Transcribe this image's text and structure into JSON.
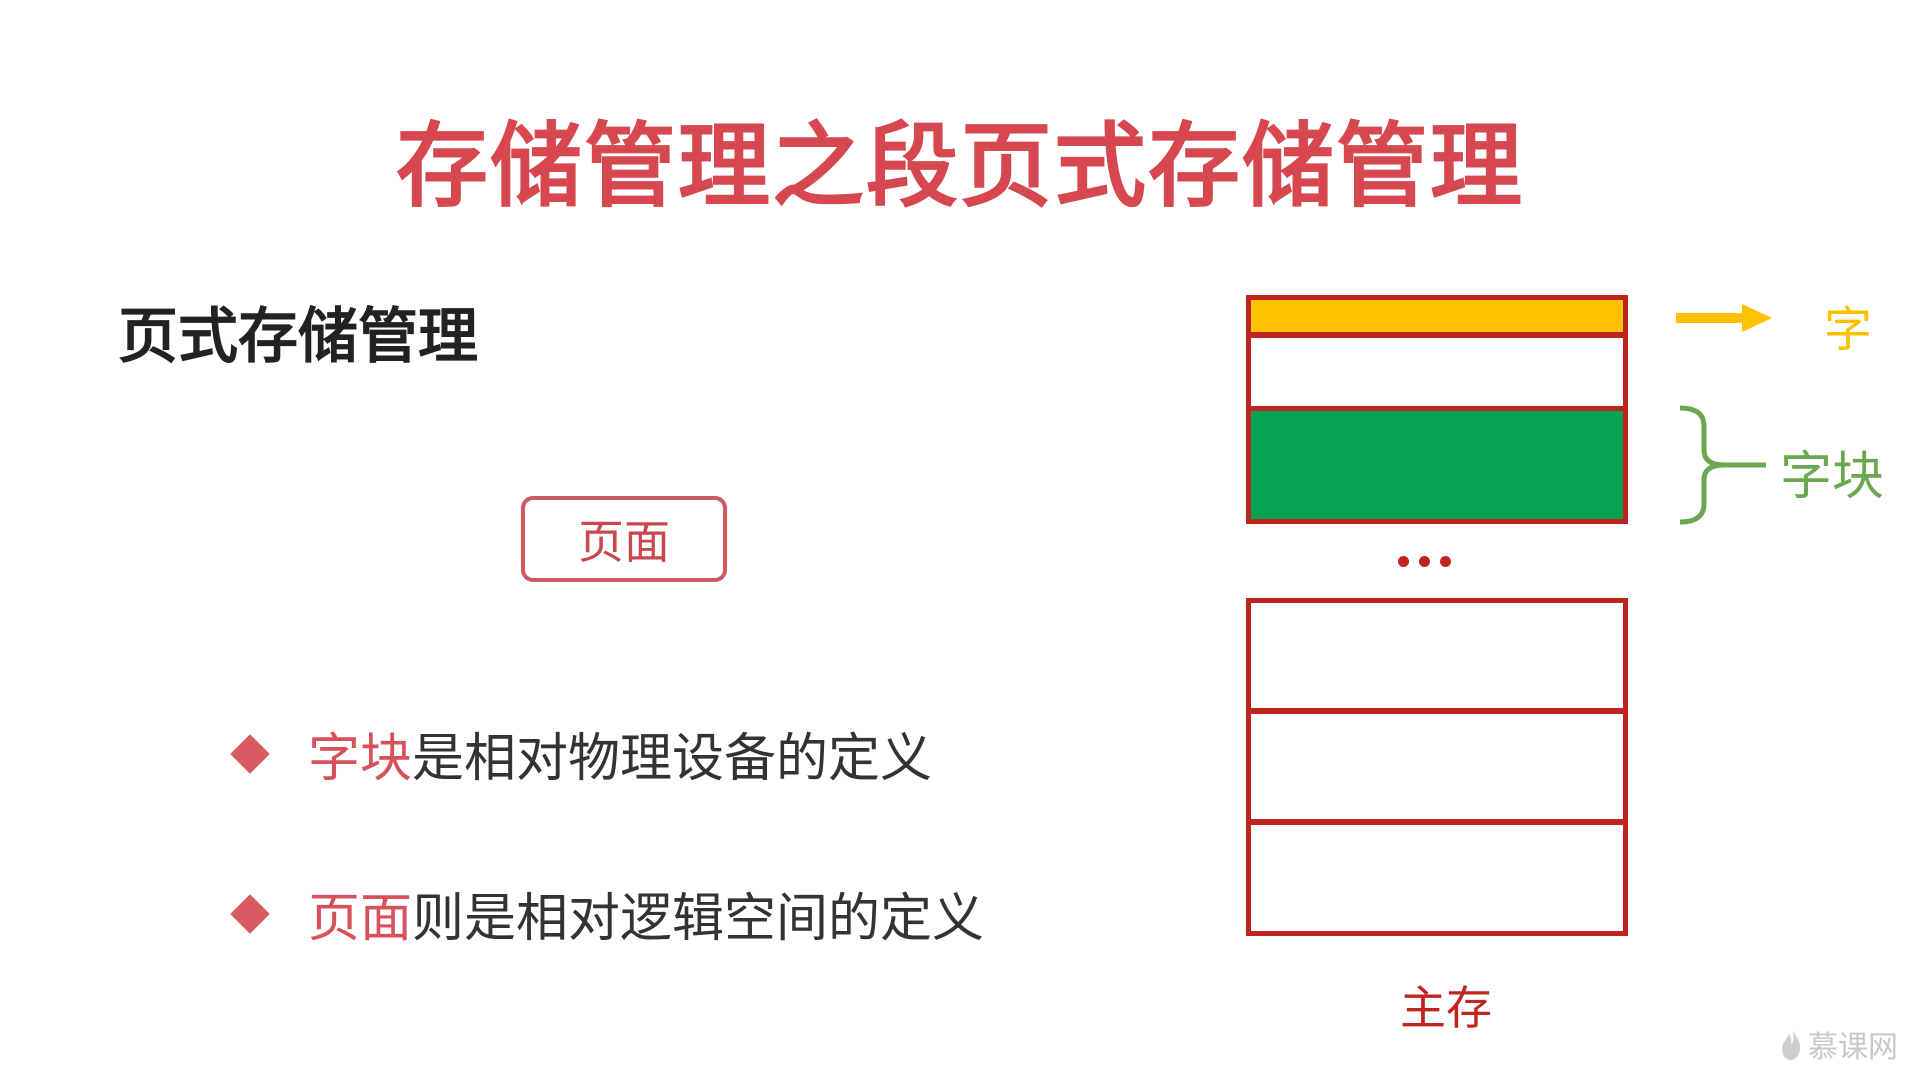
{
  "title": "存储管理之段页式存储管理",
  "subtitle": "页式存储管理",
  "page_box_label": "页面",
  "bullets": [
    {
      "highlight": "字块",
      "rest": "是相对物理设备的定义"
    },
    {
      "highlight": "页面",
      "rest": "则是相对逻辑空间的定义"
    }
  ],
  "diagram": {
    "word_label": "字",
    "block_label": "字块",
    "memory_label": "主存",
    "ellipsis": "..."
  },
  "watermark": "慕课网",
  "colors": {
    "title": "#d7474f",
    "highlight": "#d8505a",
    "memory_border": "#c0241f",
    "word_row": "#ffc000",
    "block_row": "#05a351",
    "block_brace": "#6aa84f"
  }
}
